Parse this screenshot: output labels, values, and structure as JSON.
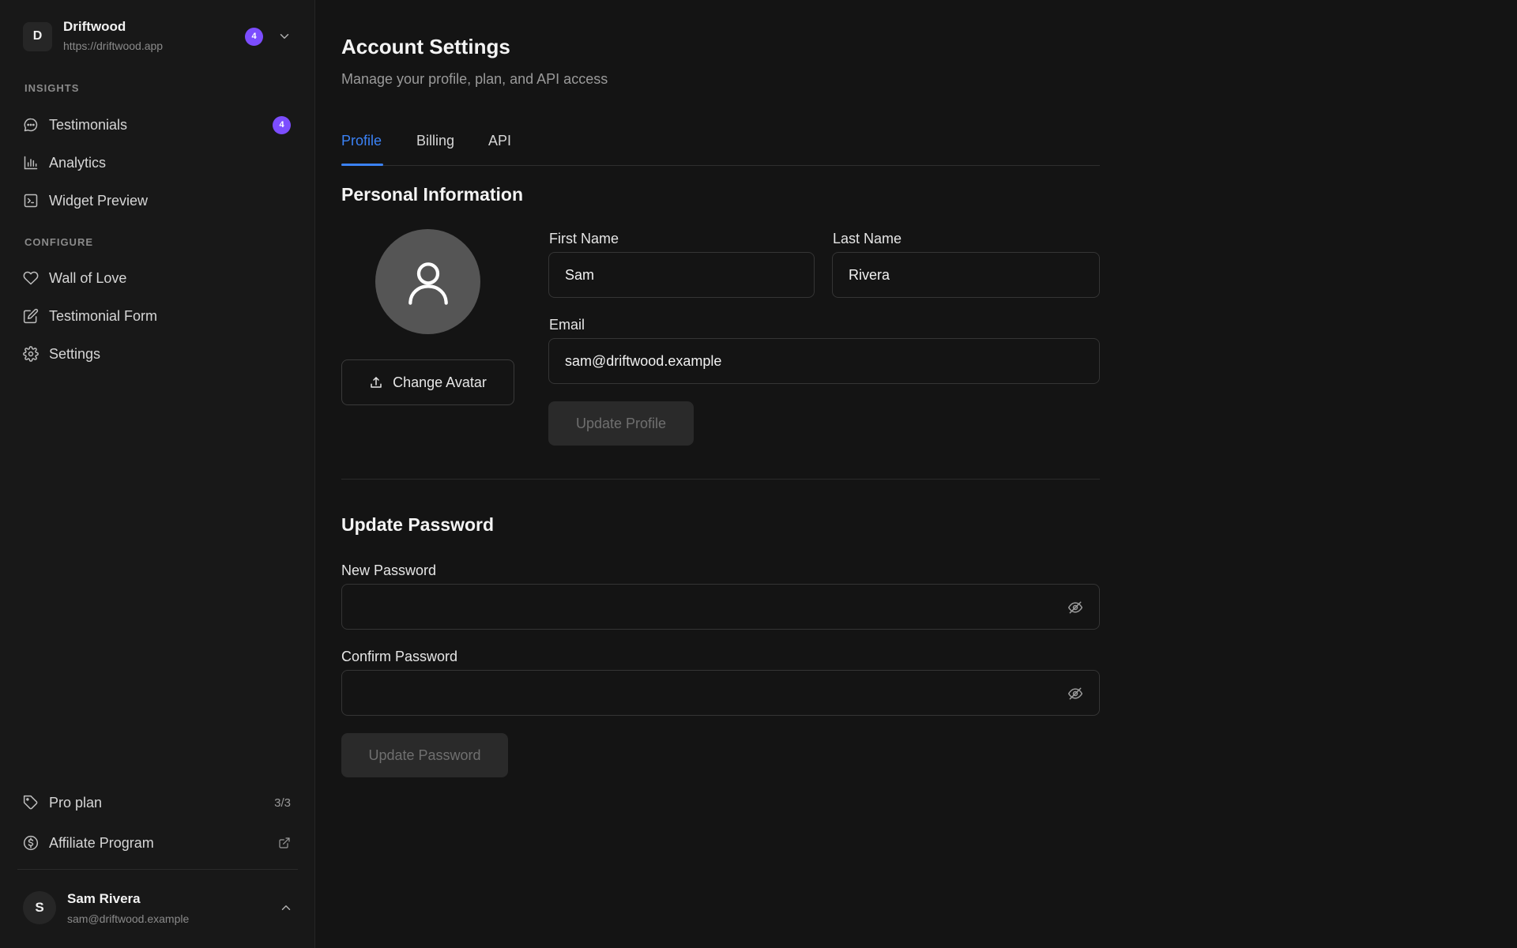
{
  "workspace": {
    "initial": "D",
    "name": "Driftwood",
    "url": "https://driftwood.app",
    "badge": "4"
  },
  "sidebar": {
    "sections": [
      {
        "label": "INSIGHTS",
        "items": [
          {
            "label": "Testimonials",
            "icon": "chat-bubble-icon",
            "badge": "4"
          },
          {
            "label": "Analytics",
            "icon": "bar-chart-icon"
          },
          {
            "label": "Widget Preview",
            "icon": "terminal-icon"
          }
        ]
      },
      {
        "label": "CONFIGURE",
        "items": [
          {
            "label": "Wall of Love",
            "icon": "heart-icon"
          },
          {
            "label": "Testimonial Form",
            "icon": "edit-icon"
          },
          {
            "label": "Settings",
            "icon": "gear-icon"
          }
        ]
      }
    ],
    "footer_items": [
      {
        "label": "Pro plan",
        "icon": "tag-icon",
        "right": "3/3"
      },
      {
        "label": "Affiliate Program",
        "icon": "dollar-circle-icon",
        "right_icon": "external-link-icon"
      }
    ],
    "user": {
      "initial": "S",
      "name": "Sam Rivera",
      "email": "sam@driftwood.example"
    }
  },
  "page": {
    "title": "Account Settings",
    "subtitle": "Manage your profile, plan, and API access"
  },
  "tabs": [
    {
      "label": "Profile",
      "active": true
    },
    {
      "label": "Billing",
      "active": false
    },
    {
      "label": "API",
      "active": false
    }
  ],
  "profile": {
    "heading": "Personal Information",
    "change_avatar_label": "Change Avatar",
    "first_name_label": "First Name",
    "first_name_value": "Sam",
    "last_name_label": "Last Name",
    "last_name_value": "Rivera",
    "email_label": "Email",
    "email_value": "sam@driftwood.example",
    "update_button": "Update Profile"
  },
  "password": {
    "heading": "Update Password",
    "new_label": "New Password",
    "new_value": "",
    "confirm_label": "Confirm Password",
    "confirm_value": "",
    "update_button": "Update Password"
  },
  "colors": {
    "accent": "#3b82f6",
    "badge": "#7c4dff",
    "background": "#141414",
    "sidebar": "#181818"
  }
}
